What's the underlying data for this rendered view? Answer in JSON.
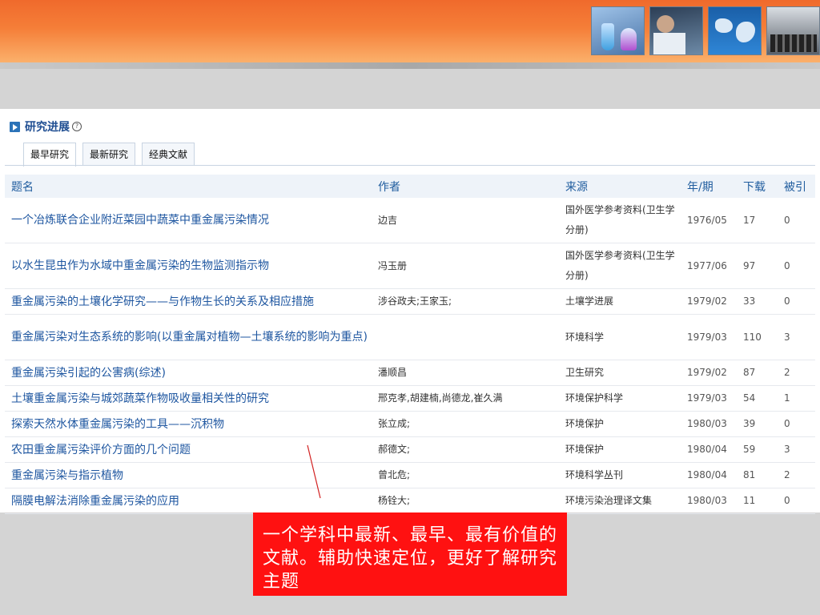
{
  "section": {
    "title": "研究进展",
    "help": "?"
  },
  "tabs": [
    {
      "label": "最早研究",
      "active": true
    },
    {
      "label": "最新研究",
      "active": false
    },
    {
      "label": "经典文献",
      "active": false
    }
  ],
  "table": {
    "headers": [
      "题名",
      "作者",
      "来源",
      "年/期",
      "下载",
      "被引"
    ],
    "rows": [
      {
        "title": "一个冶炼联合企业附近菜园中蔬菜中重金属污染情况",
        "author": "边吉",
        "source": "国外医学参考资料(卫生学分册)",
        "issue": "1976/05",
        "downloads": "17",
        "cited": "0"
      },
      {
        "title": "以水生昆虫作为水域中重金属污染的生物监测指示物",
        "author": "冯玉册",
        "source": "国外医学参考资料(卫生学分册)",
        "issue": "1977/06",
        "downloads": "97",
        "cited": "0"
      },
      {
        "title": "重金属污染的土壤化学研究——与作物生长的关系及相应措施",
        "author": "涉谷政夫;王家玉;",
        "source": "土壤学进展",
        "issue": "1979/02",
        "downloads": "33",
        "cited": "0"
      },
      {
        "title": "重金属污染对生态系统的影响(以重金属对植物—土壤系统的影响为重点)",
        "author": "",
        "source": "环境科学",
        "issue": "1979/03",
        "downloads": "110",
        "cited": "3"
      },
      {
        "title": "重金属污染引起的公害病(综述)",
        "author": "潘顺昌",
        "source": "卫生研究",
        "issue": "1979/02",
        "downloads": "87",
        "cited": "2"
      },
      {
        "title": "土壤重金属污染与城郊蔬菜作物吸收量相关性的研究",
        "author": "邢克孝,胡建楠,尚德龙,崔久满",
        "source": "环境保护科学",
        "issue": "1979/03",
        "downloads": "54",
        "cited": "1"
      },
      {
        "title": "探索天然水体重金属污染的工具——沉积物",
        "author": "张立成;",
        "source": "环境保护",
        "issue": "1980/03",
        "downloads": "39",
        "cited": "0"
      },
      {
        "title": "农田重金属污染评价方面的几个问题",
        "author": "郝德文;",
        "source": "环境保护",
        "issue": "1980/04",
        "downloads": "59",
        "cited": "3"
      },
      {
        "title": "重金属污染与指示植物",
        "author": "曾北危;",
        "source": "环境科学丛刊",
        "issue": "1980/04",
        "downloads": "81",
        "cited": "2"
      },
      {
        "title": "隔膜电解法消除重金属污染的应用",
        "author": "杨铨大;",
        "source": "环境污染治理译文集",
        "issue": "1980/03",
        "downloads": "11",
        "cited": "0"
      }
    ]
  },
  "callout": {
    "text": "一个学科中最新、最早、最有价值的文献。辅助快速定位，更好了解研究主题"
  },
  "colors": {
    "header_orange": "#f57e38",
    "link_blue": "#1e56a0",
    "callout_red": "#ff1111"
  },
  "header_images": [
    "lab-glassware-image",
    "researcher-image",
    "world-map-image",
    "lecture-hall-image"
  ]
}
